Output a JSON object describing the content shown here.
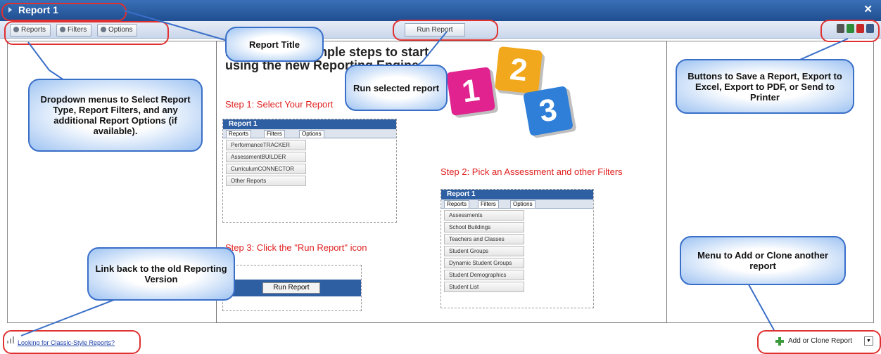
{
  "window": {
    "title": "Report 1",
    "close_glyph": "✕"
  },
  "toolbar": {
    "reports_label": "Reports",
    "filters_label": "Filters",
    "options_label": "Options",
    "run_report_label": "Run Report",
    "export_icons": [
      "save-report-icon",
      "export-excel-icon",
      "export-pdf-icon",
      "print-icon"
    ]
  },
  "content": {
    "heading": "Follow these simple steps to start using the new Reporting Engine",
    "step1": "Step 1:  Select Your Report",
    "step2": "Step 2:  Pick an Assessment and other Filters",
    "step3": "Step 3:  Click the \"Run Report\" icon",
    "mini1": {
      "title": "Report 1",
      "tabs": [
        "Reports",
        "Filters",
        "Options"
      ],
      "items": [
        "PerformanceTRACKER",
        "AssessmentBUILDER",
        "CurriculumCONNECTOR",
        "Other Reports"
      ]
    },
    "mini2": {
      "title": "Report 1",
      "tabs": [
        "Reports",
        "Filters",
        "Options"
      ],
      "items": [
        "Assessments",
        "School Buildings",
        "Teachers and Classes",
        "Student Groups",
        "Dynamic Student Groups",
        "Student Demographics",
        "Student List"
      ]
    },
    "mini3": {
      "button": "Run Report"
    },
    "blocks": [
      "1",
      "2",
      "3"
    ]
  },
  "callouts": {
    "report_title": "Report Title",
    "run_selected": "Run selected report",
    "dropdowns": "Dropdown menus to Select Report Type, Report Filters, and any additional Report Options (if available).",
    "buttons": "Buttons to Save a Report, Export to Excel, Export to PDF, or Send to Printer",
    "link_back": "Link back to the old Reporting Version",
    "add_clone": "Menu to Add or Clone another report"
  },
  "footer": {
    "classic_link": "Looking for Classic-Style Reports?",
    "add_clone_label": "Add or Clone Report"
  },
  "colors": {
    "titlebar": "#2a5ea3",
    "callout_border": "#3a6fc8",
    "annotation_red": "#e03030",
    "step_red": "#e02020"
  }
}
